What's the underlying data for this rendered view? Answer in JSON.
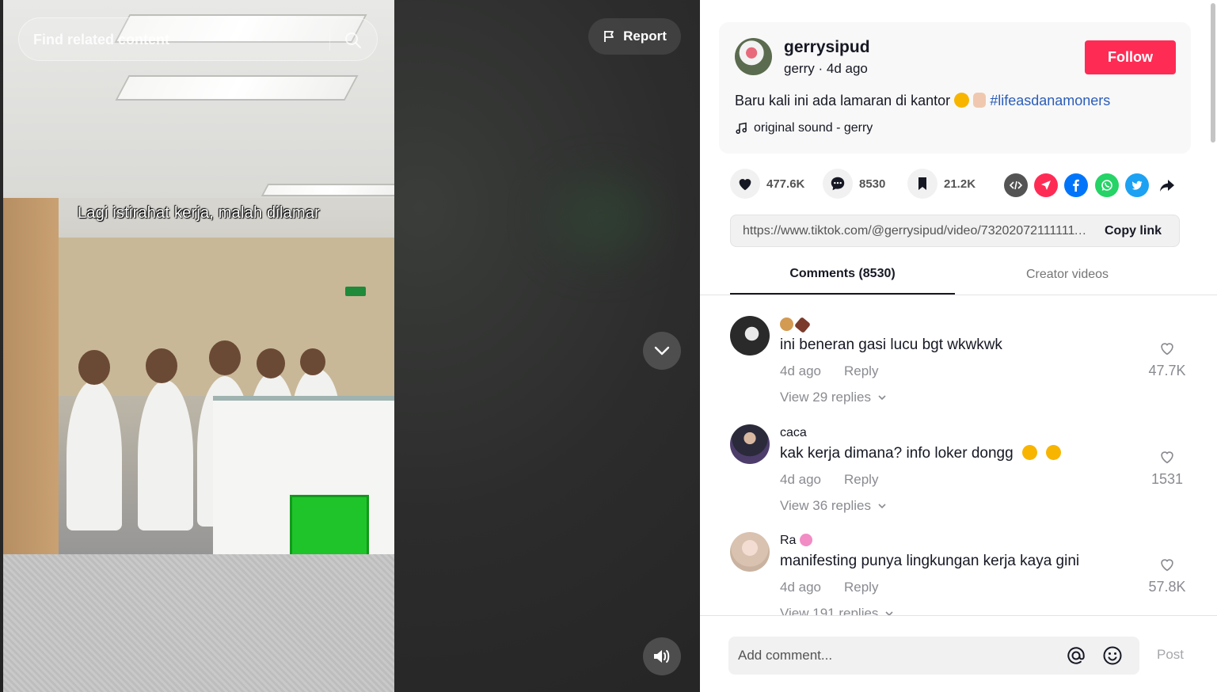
{
  "video": {
    "search_placeholder": "Find related content",
    "caption": "Lagi istirahat kerja, malah dilamar",
    "report_label": "Report"
  },
  "author": {
    "username": "gerrysipud",
    "nickname": "gerry",
    "time": "4d ago",
    "follow_label": "Follow"
  },
  "description": {
    "text": "Baru kali ini ada lamaran di kantor",
    "hashtag": "#lifeasdanamoners",
    "sound": "original sound - gerry"
  },
  "stats": {
    "likes": "477.6K",
    "comments": "8530",
    "saves": "21.2K"
  },
  "share_icons": [
    "embed-icon",
    "send-icon",
    "facebook-icon",
    "whatsapp-icon",
    "twitter-icon",
    "share-arrow-icon"
  ],
  "link": {
    "url": "https://www.tiktok.com/@gerrysipud/video/7320207211111111111",
    "copy_label": "Copy link"
  },
  "tabs": {
    "comments": "Comments (8530)",
    "creator_videos": "Creator videos"
  },
  "comments": [
    {
      "name": "",
      "text": "ini beneran gasi lucu bgt wkwkwk",
      "time": "4d ago",
      "reply": "Reply",
      "view_replies": "View 29 replies",
      "likes": "47.7K"
    },
    {
      "name": "caca",
      "text": "kak kerja dimana? info loker dongg",
      "time": "4d ago",
      "reply": "Reply",
      "view_replies": "View 36 replies",
      "likes": "1531"
    },
    {
      "name": "Ra",
      "text": "manifesting punya lingkungan kerja kaya gini",
      "time": "4d ago",
      "reply": "Reply",
      "view_replies": "View 191 replies",
      "likes": "57.8K"
    }
  ],
  "composer": {
    "placeholder": "Add comment...",
    "post_label": "Post"
  },
  "colors": {
    "accent": "#fe2c55",
    "hashtag": "#2b5db9",
    "muted": "#8a8b91"
  }
}
